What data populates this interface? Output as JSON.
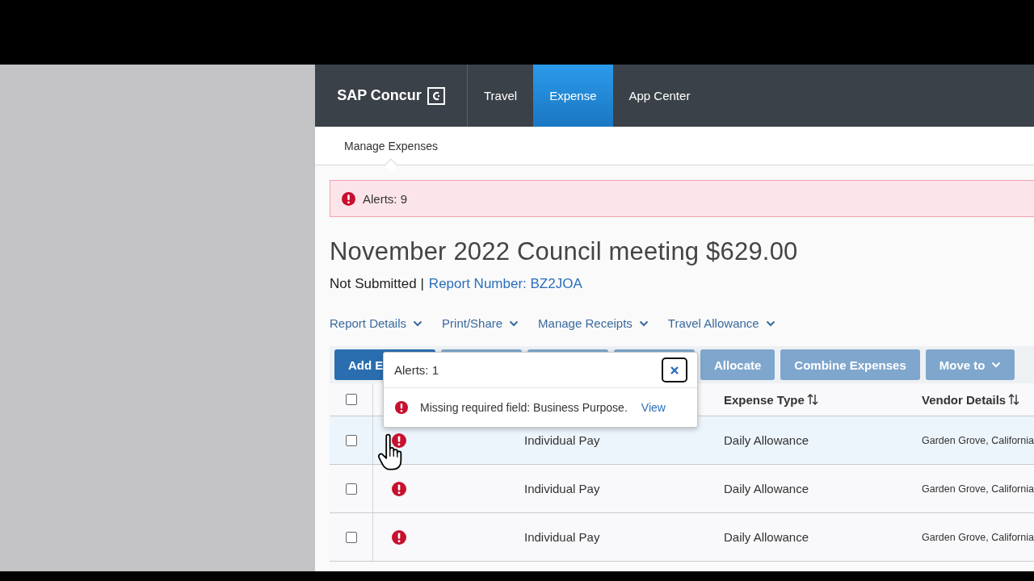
{
  "header": {
    "logo": "SAP Concur",
    "tabs": [
      {
        "label": "Travel",
        "selected": false
      },
      {
        "label": "Expense",
        "selected": true
      },
      {
        "label": "App Center",
        "selected": false
      }
    ]
  },
  "subnav": {
    "items": [
      {
        "label": "Manage Expenses",
        "selected": true
      }
    ]
  },
  "alerts_bar": {
    "text": "Alerts: 9"
  },
  "report": {
    "title": "November 2022 Council meeting $629.00",
    "status": "Not Submitted |",
    "number": "Report Number: BZ2JOA"
  },
  "menus": [
    "Report Details",
    "Print/Share",
    "Manage Receipts",
    "Travel Allowance"
  ],
  "toolbar": [
    {
      "label": "Add E",
      "disabled": false
    },
    {
      "disabled": true
    },
    {
      "disabled": true
    },
    {
      "disabled": true
    },
    {
      "label": "Allocate",
      "disabled": true
    },
    {
      "label": "Combine Expenses",
      "disabled": true
    },
    {
      "label": "Move to",
      "disabled": true,
      "dropdown": true
    }
  ],
  "table": {
    "select_all_checked": false,
    "columns": [
      "",
      "",
      "",
      "Expense Type",
      "Vendor Details"
    ],
    "rows": [
      {
        "checked": false,
        "alert": true,
        "selected": true,
        "payment": "Individual Pay",
        "expense_type": "Daily Allowance",
        "vendor": "Garden Grove, California"
      },
      {
        "checked": false,
        "alert": true,
        "selected": false,
        "payment": "Individual Pay",
        "expense_type": "Daily Allowance",
        "vendor": "Garden Grove, California"
      },
      {
        "checked": false,
        "alert": true,
        "selected": false,
        "payment": "Individual Pay",
        "expense_type": "Daily Allowance",
        "vendor": "Garden Grove, California"
      }
    ]
  },
  "popup": {
    "title": "Alerts: 1",
    "message": "Missing required field: Business Purpose.",
    "link": "View"
  }
}
